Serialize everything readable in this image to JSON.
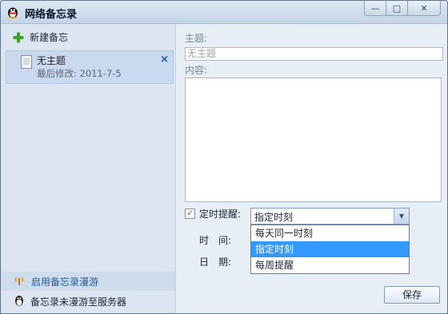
{
  "window": {
    "title": "网络备忘录",
    "minimize": "—",
    "maximize": "□",
    "close": "✕"
  },
  "sidebar": {
    "new_memo": "新建备忘",
    "memo": {
      "title": "无主题",
      "date": "最后修改: 2011-7-5",
      "delete": "×"
    },
    "roam_link": "启用备忘录漫游",
    "roam_status": "备忘录未漫游至服务器"
  },
  "editor": {
    "subject_label": "主题:",
    "subject_placeholder": "无主题",
    "content_label": "内容:",
    "remind_label": "定时提醒:",
    "remind_checked": true,
    "remind_check_glyph": "✓",
    "select_value": "指定时刻",
    "select_arrow": "▼",
    "options": [
      "每天同一时刻",
      "指定时刻",
      "每周提醒"
    ],
    "selected_option": "指定时刻",
    "time_label": "时　间:",
    "date_label": "日　期:",
    "save": "保存"
  },
  "icons": {
    "app": "qq-penguin-icon",
    "new_memo": "plus-icon",
    "memo": "document-icon",
    "roam": "broadcast-icon",
    "roam_status": "penguin-icon"
  },
  "colors": {
    "selection": "#3399ff",
    "link": "#1a5ba8",
    "sidebar_bg": "#dde6f0",
    "selected_item_bg": "#c9daf0"
  }
}
